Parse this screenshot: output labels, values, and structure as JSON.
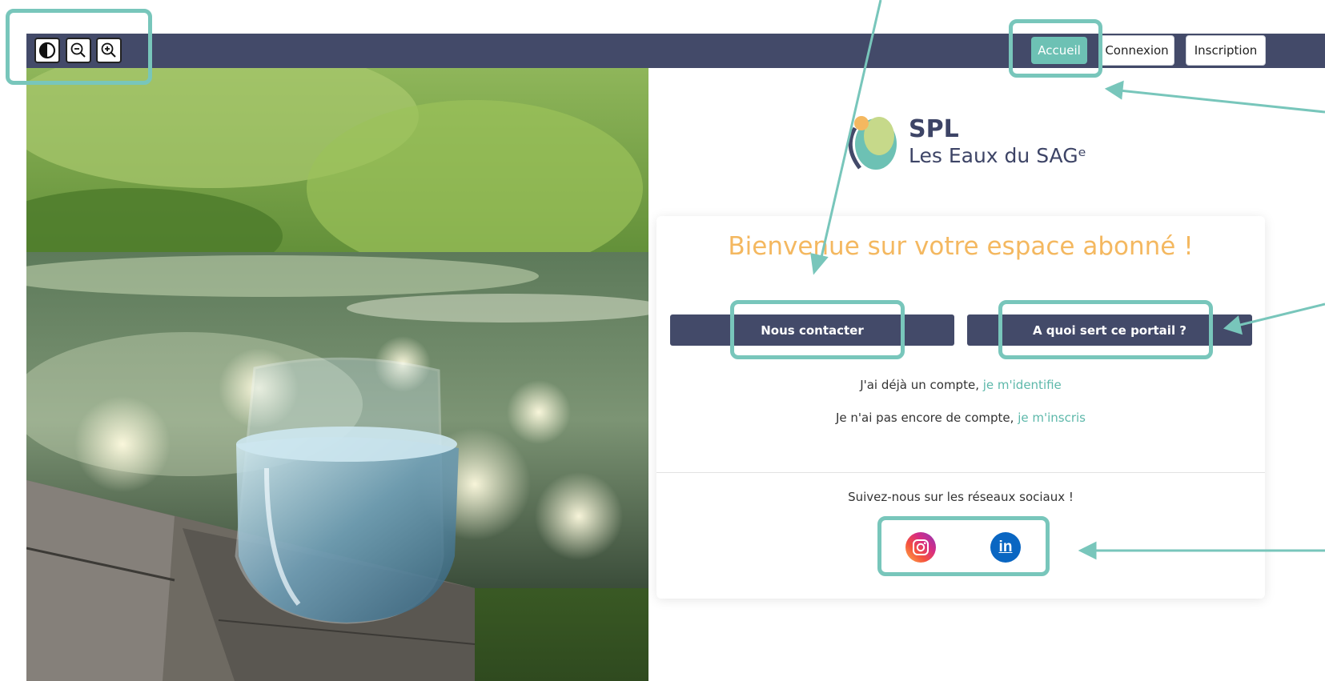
{
  "toolbar": {
    "buttons": [
      {
        "icon": "contrast-icon"
      },
      {
        "icon": "zoom-out-icon"
      },
      {
        "icon": "zoom-in-icon"
      }
    ]
  },
  "nav": {
    "accueil": "Accueil",
    "connexion": "Connexion",
    "inscription": "Inscription"
  },
  "logo": {
    "title": "SPL",
    "subtitle": "Les Eaux du SAGᵉ"
  },
  "main": {
    "welcome": "Bienvenue sur votre espace abonné !",
    "contact_button": "Nous contacter",
    "portal_button": "A quoi sert ce portail ?",
    "account_prefix": "J'ai déjà un compte, ",
    "account_link": "je m'identifie",
    "no_account_prefix": "Je n'ai pas encore de compte, ",
    "no_account_link": "je m'inscris",
    "social_heading": "Suivez-nous sur les réseaux sociaux !",
    "social": [
      {
        "icon": "instagram-icon"
      },
      {
        "icon": "linkedin-icon",
        "text": "in"
      }
    ]
  },
  "colors": {
    "navbar": "#434a69",
    "accent": "#6dc1b4",
    "welcome": "#f4b860",
    "annotation": "#78c6bb"
  }
}
